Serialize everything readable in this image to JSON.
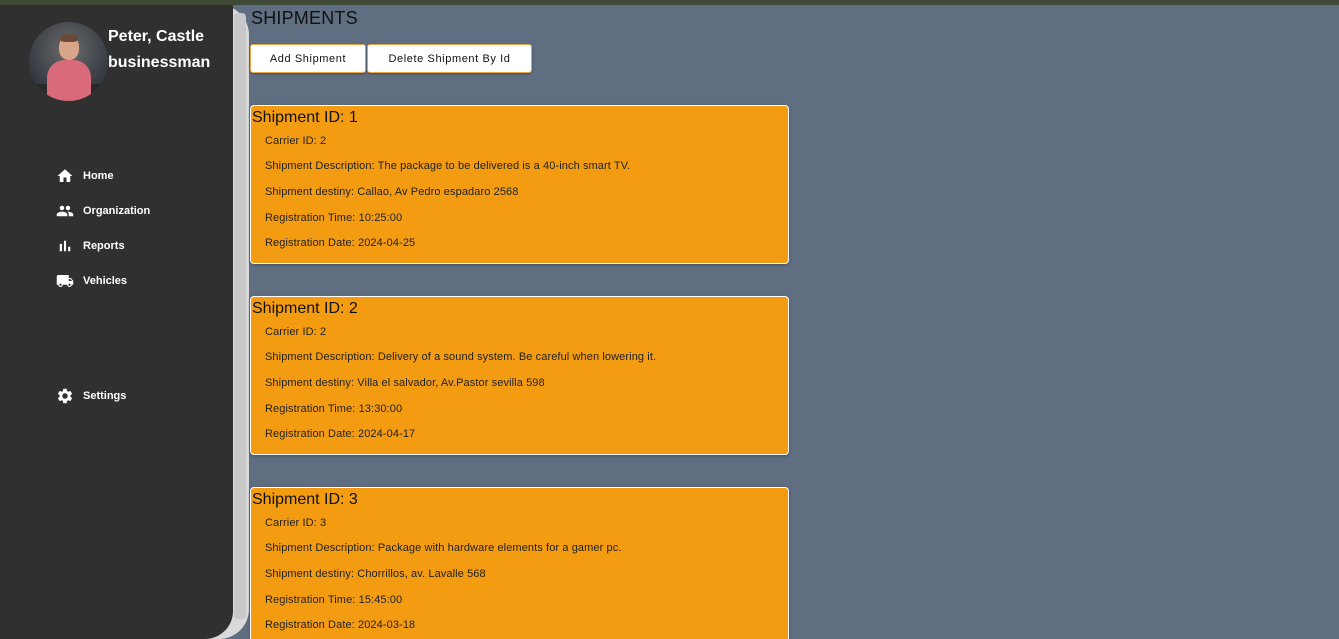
{
  "user": {
    "name": "Peter, Castle",
    "role": "businessman"
  },
  "nav": [
    {
      "label": "Home",
      "icon": "home-icon"
    },
    {
      "label": "Organization",
      "icon": "people-icon"
    },
    {
      "label": "Reports",
      "icon": "bar-chart-icon"
    },
    {
      "label": "Vehicles",
      "icon": "truck-icon"
    },
    {
      "label": "Settings",
      "icon": "gear-icon"
    }
  ],
  "page": {
    "title": "SHIPMENTS",
    "add_label": "Add Shipment",
    "delete_label": "Delete Shipment By Id"
  },
  "shipments": [
    {
      "title": "Shipment ID: 1",
      "carrier": "Carrier ID: 2",
      "description": "Shipment Description: The package to be delivered is a 40-inch smart TV.",
      "destiny": "Shipment destiny: Callao, Av Pedro espadaro 2568",
      "time": "Registration Time: 10:25:00",
      "date": "Registration Date: 2024-04-25"
    },
    {
      "title": "Shipment ID: 2",
      "carrier": "Carrier ID: 2",
      "description": "Shipment Description: Delivery of a sound system. Be careful when lowering it.",
      "destiny": "Shipment destiny: Villa el salvador, Av.Pastor sevilla 598",
      "time": "Registration Time: 13:30:00",
      "date": "Registration Date: 2024-04-17"
    },
    {
      "title": "Shipment ID: 3",
      "carrier": "Carrier ID: 3",
      "description": "Shipment Description: Package with hardware elements for a gamer pc.",
      "destiny": "Shipment destiny: Chorrillos, av. Lavalle 568",
      "time": "Registration Time: 15:45:00",
      "date": "Registration Date: 2024-03-18"
    }
  ],
  "colors": {
    "background": "#5f6e80",
    "sidebar": "#303030",
    "card": "#f39c12"
  }
}
